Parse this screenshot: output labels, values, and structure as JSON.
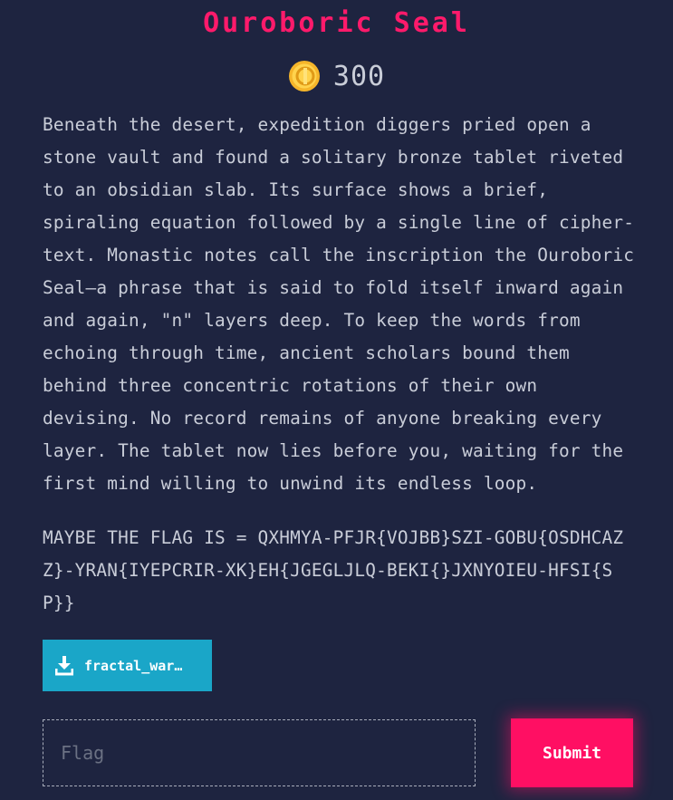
{
  "challenge": {
    "title": "Ouroboric Seal",
    "points": "300",
    "description": "Beneath the desert, expedition diggers pried open a stone vault and found a solitary bronze tablet riveted to an obsidian slab. Its surface shows a brief, spiraling equation followed by a single line of cipher-text. Monastic notes call the inscription the Ouroboric Seal—a phrase that is said to fold itself inward again and again, \"n\" layers deep. To keep the words from echoing through time, ancient scholars bound them behind three concentric rotations of their own devising. No record remains of anyone breaking every layer. The tablet now lies before you, waiting for the first mind willing to unwind its endless loop.",
    "flag_hint": "MAYBE THE FLAG IS = QXHMYA-PFJR{VOJBB}SZI-GOBU{OSDHCAZZ}-YRAN{IYEPCRIR-XK}EH{JGEGLJLQ-BEKI{}JXNYOIEU-HFSI{SP}}"
  },
  "download": {
    "label": "fractal_war…",
    "icon": "download-icon"
  },
  "form": {
    "flag_placeholder": "Flag",
    "flag_value": "",
    "submit_label": "Submit"
  },
  "colors": {
    "background": "#1e2440",
    "title": "#ff1a6b",
    "text": "#c9cdd8",
    "download_button": "#1aa6c8",
    "submit_button": "#ff0f63",
    "coin": "#f5c542"
  }
}
